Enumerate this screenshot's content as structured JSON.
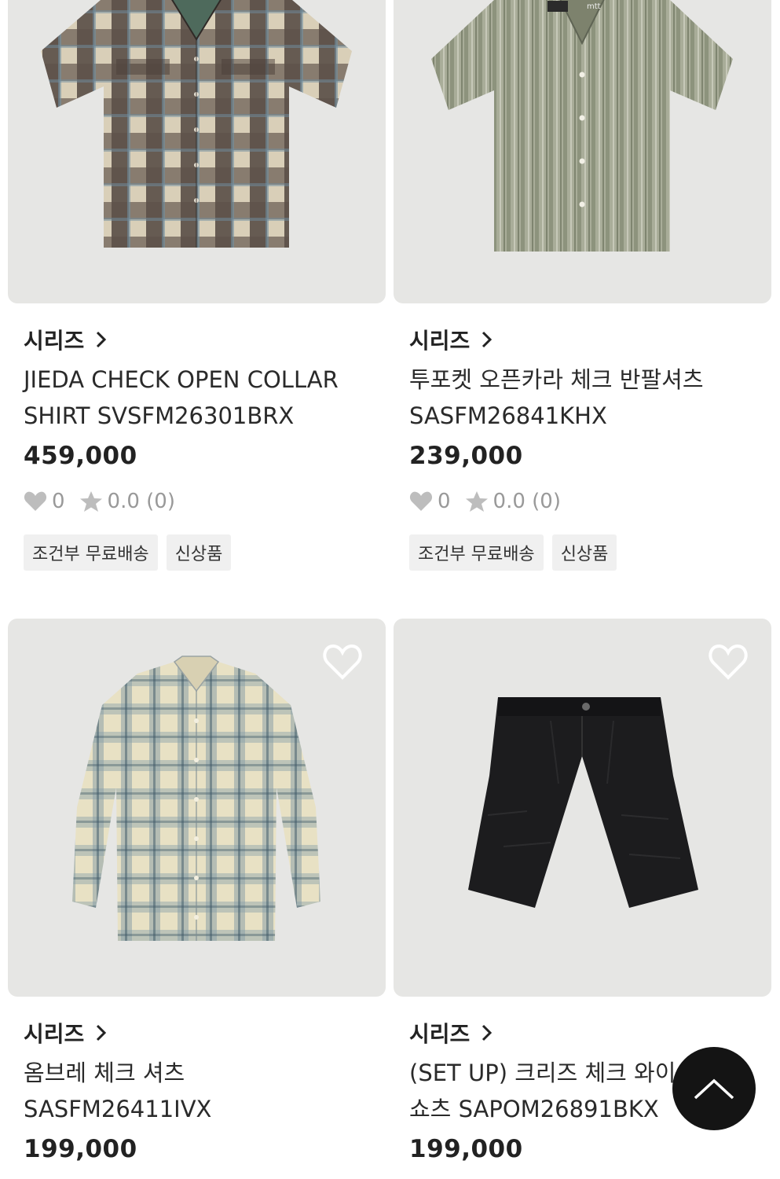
{
  "products": [
    {
      "series": "시리즈",
      "title": "JIEDA CHECK OPEN COLLAR\nSHIRT SVSFM26301BRX",
      "price": "459,000",
      "wish_count": "0",
      "rating": "0.0 (0)",
      "badges": [
        "조건부 무료배송",
        "신상품"
      ]
    },
    {
      "series": "시리즈",
      "title": "투포켓 오픈카라 체크 반팔셔츠\nSASFM26841KHX",
      "price": "239,000",
      "wish_count": "0",
      "rating": "0.0 (0)",
      "badges": [
        "조건부 무료배송",
        "신상품"
      ]
    },
    {
      "series": "시리즈",
      "title": "옴브레 체크 셔츠\nSASFM26411IVX",
      "price": "199,000"
    },
    {
      "series": "시리즈",
      "title": "(SET UP) 크리즈 체크 와이\n쇼츠 SAPOM26891BKX",
      "price": "199,000"
    }
  ],
  "colors": {
    "image_bg": "#e6e6e4",
    "badge_bg": "#f0f0f0",
    "top_button": "#141414"
  },
  "icons": {
    "wish": "heart-outline-icon",
    "stat_heart": "heart-filled-icon",
    "stat_star": "star-filled-icon",
    "series_arrow": "chevron-right-icon",
    "scroll_top": "chevron-up-icon"
  }
}
